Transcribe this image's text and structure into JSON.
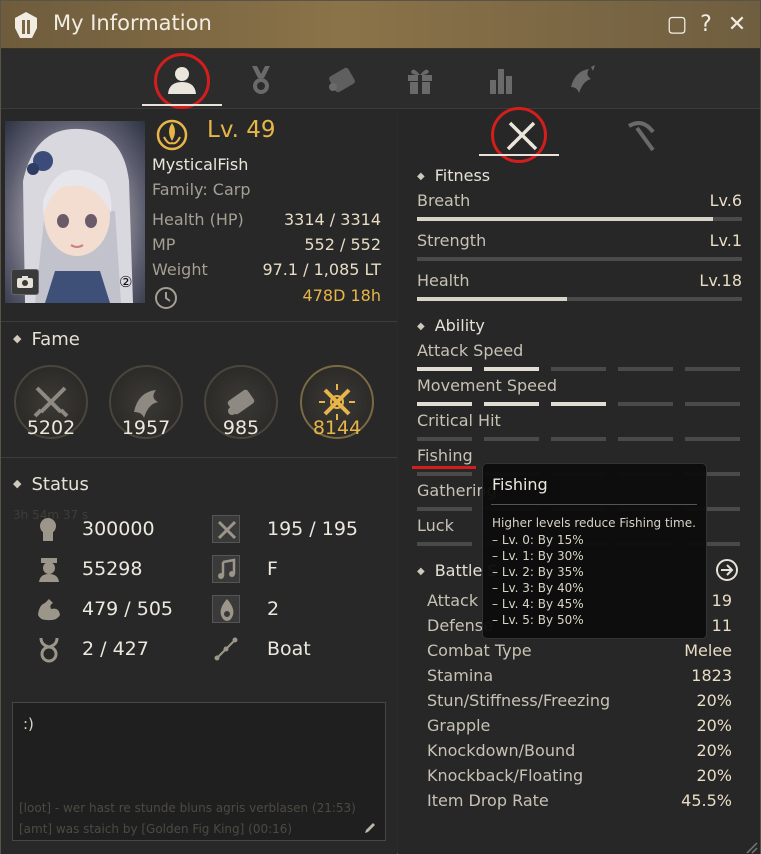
{
  "window": {
    "title": "My Information",
    "buttons": [
      "▢",
      "?",
      "✕"
    ]
  },
  "tabs": [
    {
      "name": "tab-character",
      "icon": "person-icon",
      "active": true
    },
    {
      "name": "tab-achievement",
      "icon": "medal-icon",
      "active": false
    },
    {
      "name": "tab-quest",
      "icon": "scroll-icon",
      "active": false
    },
    {
      "name": "tab-gift",
      "icon": "gift-icon",
      "active": false
    },
    {
      "name": "tab-stats",
      "icon": "bar-chart-icon",
      "active": false
    },
    {
      "name": "tab-fishing",
      "icon": "fish-icon",
      "active": false
    }
  ],
  "character": {
    "portrait_badge": "②",
    "level": "Lv. 49",
    "name": "MysticalFish",
    "family": "Family: Carp",
    "stats": [
      {
        "label": "Health (HP)",
        "value": "3314 / 3314"
      },
      {
        "label": "MP",
        "value": "552 / 552"
      },
      {
        "label": "Weight",
        "value": "97.1 / 1,085 LT"
      }
    ],
    "playtime": "478D 18h"
  },
  "fame": {
    "title": "Fame",
    "items": [
      {
        "icon": "combat-fame-icon",
        "value": "5202"
      },
      {
        "icon": "life-fame-icon",
        "value": "1957"
      },
      {
        "icon": "scroll-fame-icon",
        "value": "985"
      },
      {
        "icon": "total-fame-icon",
        "value": "8144"
      }
    ]
  },
  "status": {
    "title": "Status",
    "left": [
      {
        "icon": "head-icon",
        "value": "300000"
      },
      {
        "icon": "officer-icon",
        "value": "55298"
      },
      {
        "icon": "strength-arm-icon",
        "value": "479 / 505"
      },
      {
        "icon": "horns-icon",
        "value": "2 / 427"
      }
    ],
    "right": [
      {
        "icon": "tools-icon",
        "value": "195 / 195"
      },
      {
        "icon": "music-note-icon",
        "value": "F"
      },
      {
        "icon": "flame-icon",
        "value": "2"
      },
      {
        "icon": "boat-icon",
        "value": "Boat"
      }
    ]
  },
  "memo": {
    "text": ":)",
    "chat_lines": [
      "[loot] - wer hast re stunde bluns agris verblasen (21:53)",
      "[amt] was staich by [Golden Fig King] (00:16)"
    ],
    "faded_timer": "3h 54m 37 s"
  },
  "right_tabs": [
    {
      "name": "combat",
      "icon": "crossed-swords-icon",
      "active": true
    },
    {
      "name": "life",
      "icon": "sickle-icon",
      "active": false
    }
  ],
  "fitness": {
    "title": "Fitness",
    "items": [
      {
        "label": "Breath",
        "level": "Lv.6",
        "progress": 0.91
      },
      {
        "label": "Strength",
        "level": "Lv.1",
        "progress": 0.0
      },
      {
        "label": "Health",
        "level": "Lv.18",
        "progress": 0.46
      }
    ]
  },
  "ability": {
    "title": "Ability",
    "items": [
      {
        "label": "Attack Speed",
        "filled": 2
      },
      {
        "label": "Movement Speed",
        "filled": 3
      },
      {
        "label": "Critical Hit",
        "filled": 0
      },
      {
        "label": "Fishing",
        "filled": 0
      },
      {
        "label": "Gathering",
        "filled": 0
      },
      {
        "label": "Luck",
        "filled": 0
      }
    ]
  },
  "battle": {
    "title": "Battle S",
    "items": [
      {
        "label": "Attack",
        "value": "19"
      },
      {
        "label": "Defense",
        "value": "11"
      },
      {
        "label": "Combat Type",
        "value": "Melee"
      },
      {
        "label": "Stamina",
        "value": "1823"
      },
      {
        "label": "Stun/Stiffness/Freezing",
        "value": "20%"
      },
      {
        "label": "Grapple",
        "value": "20%"
      },
      {
        "label": "Knockdown/Bound",
        "value": "20%"
      },
      {
        "label": "Knockback/Floating",
        "value": "20%"
      },
      {
        "label": "Item Drop Rate",
        "value": "45.5%"
      }
    ]
  },
  "tooltip": {
    "title": "Fishing",
    "desc": "Higher levels reduce Fishing time.",
    "items": [
      "– Lv. 0: By 15%",
      "– Lv. 1: By 30%",
      "– Lv. 2: By 35%",
      "– Lv. 3: By 40%",
      "– Lv. 4: By 45%",
      "– Lv. 5: By 50%"
    ]
  },
  "colors": {
    "accent_gold": "#e8b548",
    "highlight_red": "#d41d1d",
    "title_bar": "#8b7349"
  }
}
